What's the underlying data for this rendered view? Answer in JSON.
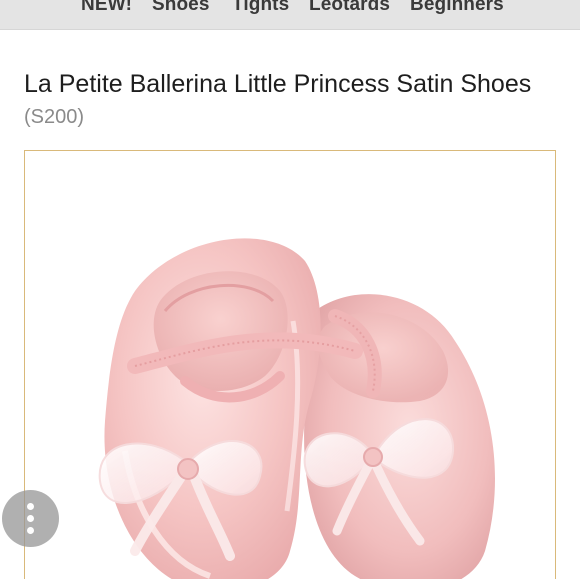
{
  "nav": {
    "items": [
      {
        "label": "NEW!"
      },
      {
        "label": "Shoes"
      },
      {
        "label": "Tights"
      },
      {
        "label": "Leotards"
      },
      {
        "label": "Beginners"
      }
    ]
  },
  "product": {
    "title": "La Petite Ballerina Little Princess Satin Shoes",
    "sku": "(S200)",
    "image_alt": "pink satin ballet slippers with organza bows"
  },
  "colors": {
    "frame_border": "#d9b97a",
    "satin_pink": "#f6c8c6"
  },
  "icons": {
    "more": "more-vertical-icon"
  }
}
